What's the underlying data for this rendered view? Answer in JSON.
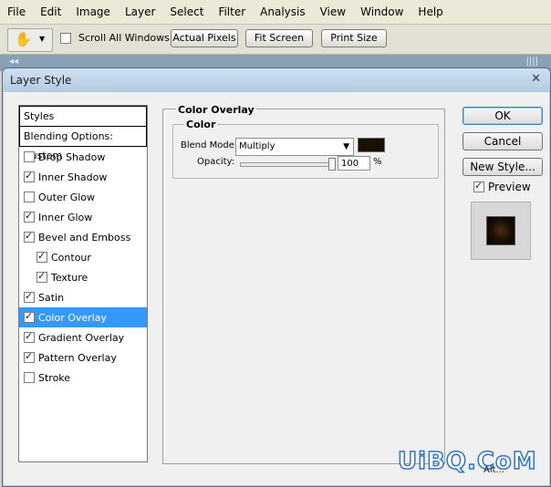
{
  "menubar": {
    "items": [
      "File",
      "Edit",
      "Image",
      "Layer",
      "Select",
      "Filter",
      "Analysis",
      "View",
      "Window",
      "Help"
    ]
  },
  "options_bar": {
    "tool_icon": "hand-icon",
    "scroll_all_windows": {
      "label": "Scroll All Windows",
      "checked": false
    },
    "actual_pixels_label": "Actual Pixels",
    "fit_screen_label": "Fit Screen",
    "print_size_label": "Print Size"
  },
  "dialog": {
    "title": "Layer Style",
    "close_icon": "close-icon",
    "styles_header": "Styles",
    "blending_header": "Blending Options: Custom",
    "styles": [
      {
        "label": "Drop Shadow",
        "checked": false,
        "indent": false,
        "selected": false
      },
      {
        "label": "Inner Shadow",
        "checked": true,
        "indent": false,
        "selected": false
      },
      {
        "label": "Outer Glow",
        "checked": false,
        "indent": false,
        "selected": false
      },
      {
        "label": "Inner Glow",
        "checked": true,
        "indent": false,
        "selected": false
      },
      {
        "label": "Bevel and Emboss",
        "checked": true,
        "indent": false,
        "selected": false
      },
      {
        "label": "Contour",
        "checked": true,
        "indent": true,
        "selected": false
      },
      {
        "label": "Texture",
        "checked": true,
        "indent": true,
        "selected": false
      },
      {
        "label": "Satin",
        "checked": true,
        "indent": false,
        "selected": false
      },
      {
        "label": "Color Overlay",
        "checked": true,
        "indent": false,
        "selected": true
      },
      {
        "label": "Gradient Overlay",
        "checked": true,
        "indent": false,
        "selected": false
      },
      {
        "label": "Pattern Overlay",
        "checked": true,
        "indent": false,
        "selected": false
      },
      {
        "label": "Stroke",
        "checked": false,
        "indent": false,
        "selected": false
      }
    ],
    "section_title": "Color Overlay",
    "group_title": "Color",
    "blend_mode_label": "Blend Mode:",
    "blend_mode_value": "Multiply",
    "overlay_color": "#1a0f03",
    "opacity_label": "Opacity:",
    "opacity_value": "100",
    "opacity_fraction": 1.0,
    "opacity_unit": "%",
    "ok_label": "OK",
    "cancel_label": "Cancel",
    "new_style_label": "New Style...",
    "preview_label": "Preview",
    "preview_checked": true
  },
  "watermark": "UiBQ.CoM",
  "bottom_text": "Alt..."
}
